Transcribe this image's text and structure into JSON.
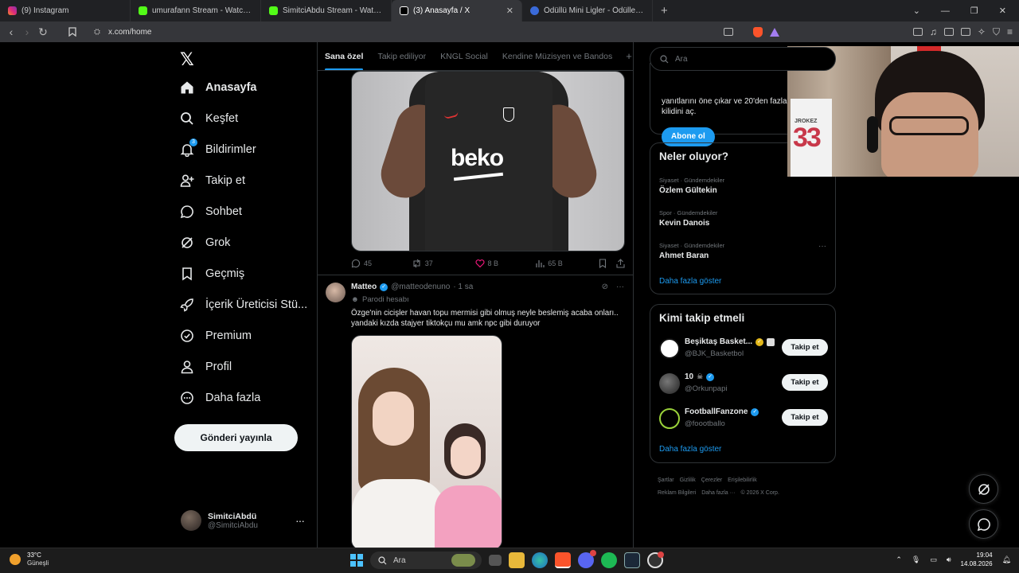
{
  "browser": {
    "tabs": [
      {
        "title": "(9) Instagram",
        "color": "#d6249f",
        "active": false
      },
      {
        "title": "umurafann Stream - Watch Live o",
        "color": "#53fc18",
        "active": false
      },
      {
        "title": "SimitciAbdu Stream - Watch Live on",
        "color": "#53fc18",
        "active": false
      },
      {
        "title": "(3) Anasayfa / X",
        "color": "#ffffff",
        "active": true
      },
      {
        "title": "Ödüllü Mini Ligler - Ödüller - TFF Fan",
        "color": "#3a6ad9",
        "active": false
      }
    ],
    "url": "x.com/home"
  },
  "nav": {
    "items": [
      {
        "label": "Anasayfa",
        "icon": "home-icon"
      },
      {
        "label": "Keşfet",
        "icon": "search-icon"
      },
      {
        "label": "Bildirimler",
        "icon": "bell-icon",
        "badge": "3"
      },
      {
        "label": "Takip et",
        "icon": "person-add-icon"
      },
      {
        "label": "Sohbet",
        "icon": "chat-icon"
      },
      {
        "label": "Grok",
        "icon": "grok-icon"
      },
      {
        "label": "Geçmiş",
        "icon": "bookmark-icon"
      },
      {
        "label": "İçerik Üreticisi Stü...",
        "icon": "rocket-icon"
      },
      {
        "label": "Premium",
        "icon": "verified-badge-icon"
      },
      {
        "label": "Profil",
        "icon": "profile-icon"
      },
      {
        "label": "Daha fazla",
        "icon": "more-circle-icon"
      }
    ],
    "post_button": "Gönderi yayınla",
    "account": {
      "name": "SimitciAbdü",
      "handle": "@SimitciAbdu"
    }
  },
  "feed": {
    "tabs": [
      "Sana özel",
      "Takip ediliyor",
      "KNGL Social",
      "Kendine Müzisyen ve Bandos"
    ],
    "post1": {
      "sponsor": "beko",
      "replies": "45",
      "reposts": "37",
      "likes": "8 B",
      "views": "65 B"
    },
    "post2": {
      "name": "Matteo",
      "handle": "@matteodenuno",
      "time": "· 1 sa",
      "label": "Parodi hesabı",
      "text": "Özge'nin cicişler havan topu mermisi gibi olmuş neyle beslemiş acaba onları.. yandaki kızda stajyer tiktokçu mu amk npc gibi duruyor"
    }
  },
  "sidebar": {
    "search_placeholder": "Ara",
    "premium_text": "yanıtlarını öne çıkar ve 20'den fazla özelliğin kilidini aç.",
    "subscribe": "Abone ol",
    "trends_title": "Neler oluyor?",
    "trends": [
      {
        "category": "Siyaset · Gündemdekiler",
        "name": "Özlem Gültekin"
      },
      {
        "category": "Spor · Gündemdekiler",
        "name": "Kevin Danois"
      },
      {
        "category": "Siyaset · Gündemdekiler",
        "name": "Ahmet Baran"
      }
    ],
    "show_more": "Daha fazla göster",
    "wtf_title": "Kimi takip etmeli",
    "wtf": [
      {
        "name": "Beşiktaş Basket...",
        "handle": "@BJK_Basketbol",
        "follow": "Takip et",
        "badge": "gold"
      },
      {
        "name": "10",
        "handle": "@Orkunpapi",
        "follow": "Takip et",
        "badge": "blue"
      },
      {
        "name": "FootballFanzone",
        "handle": "@foootballo",
        "follow": "Takip et",
        "badge": "blue"
      }
    ],
    "wtf_more": "Daha fazla göster",
    "footer": [
      "Şartlar",
      "Gizlilik",
      "Çerezler",
      "Erişilebilirlik",
      "Reklam Bilgileri",
      "Daha fazla ···",
      "© 2026 X Corp."
    ]
  },
  "webcam": {
    "jersey_name": "JROKEZ",
    "jersey_number": "33"
  },
  "taskbar": {
    "temperature": "33°C",
    "condition": "Güneşli",
    "search": "Ara",
    "time": "19:04",
    "date": "14.08.2026"
  }
}
